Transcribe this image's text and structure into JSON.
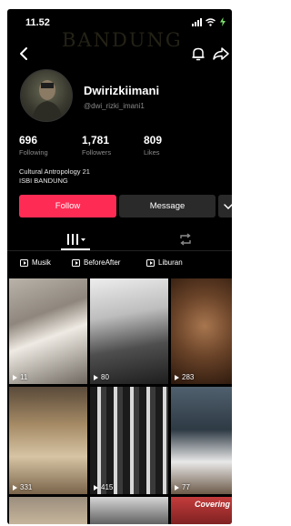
{
  "status_bar": {
    "time": "11.52"
  },
  "watermark": "BANDUNG",
  "profile": {
    "display_name": "Dwirizkiimani",
    "username": "@dwi_rizki_imani1",
    "bio_line1": "Cultural Antropology 21",
    "bio_line2": "ISBI BANDUNG"
  },
  "stats": [
    {
      "value": "696",
      "label": "Following"
    },
    {
      "value": "1,781",
      "label": "Followers"
    },
    {
      "value": "809",
      "label": "Likes"
    }
  ],
  "actions": {
    "follow_label": "Follow",
    "message_label": "Message"
  },
  "playlists": [
    "Musik",
    "BeforeAfter",
    "Liburan"
  ],
  "videos": [
    {
      "views": "11"
    },
    {
      "views": "80"
    },
    {
      "views": "283"
    },
    {
      "views": "331"
    },
    {
      "views": "415"
    },
    {
      "views": "77"
    },
    {
      "views": ""
    },
    {
      "views": ""
    },
    {
      "views": "",
      "caption": "Covering"
    }
  ],
  "colors": {
    "follow": "#fe2c55",
    "background": "#000000",
    "secondary_button": "#2a2a2a"
  }
}
